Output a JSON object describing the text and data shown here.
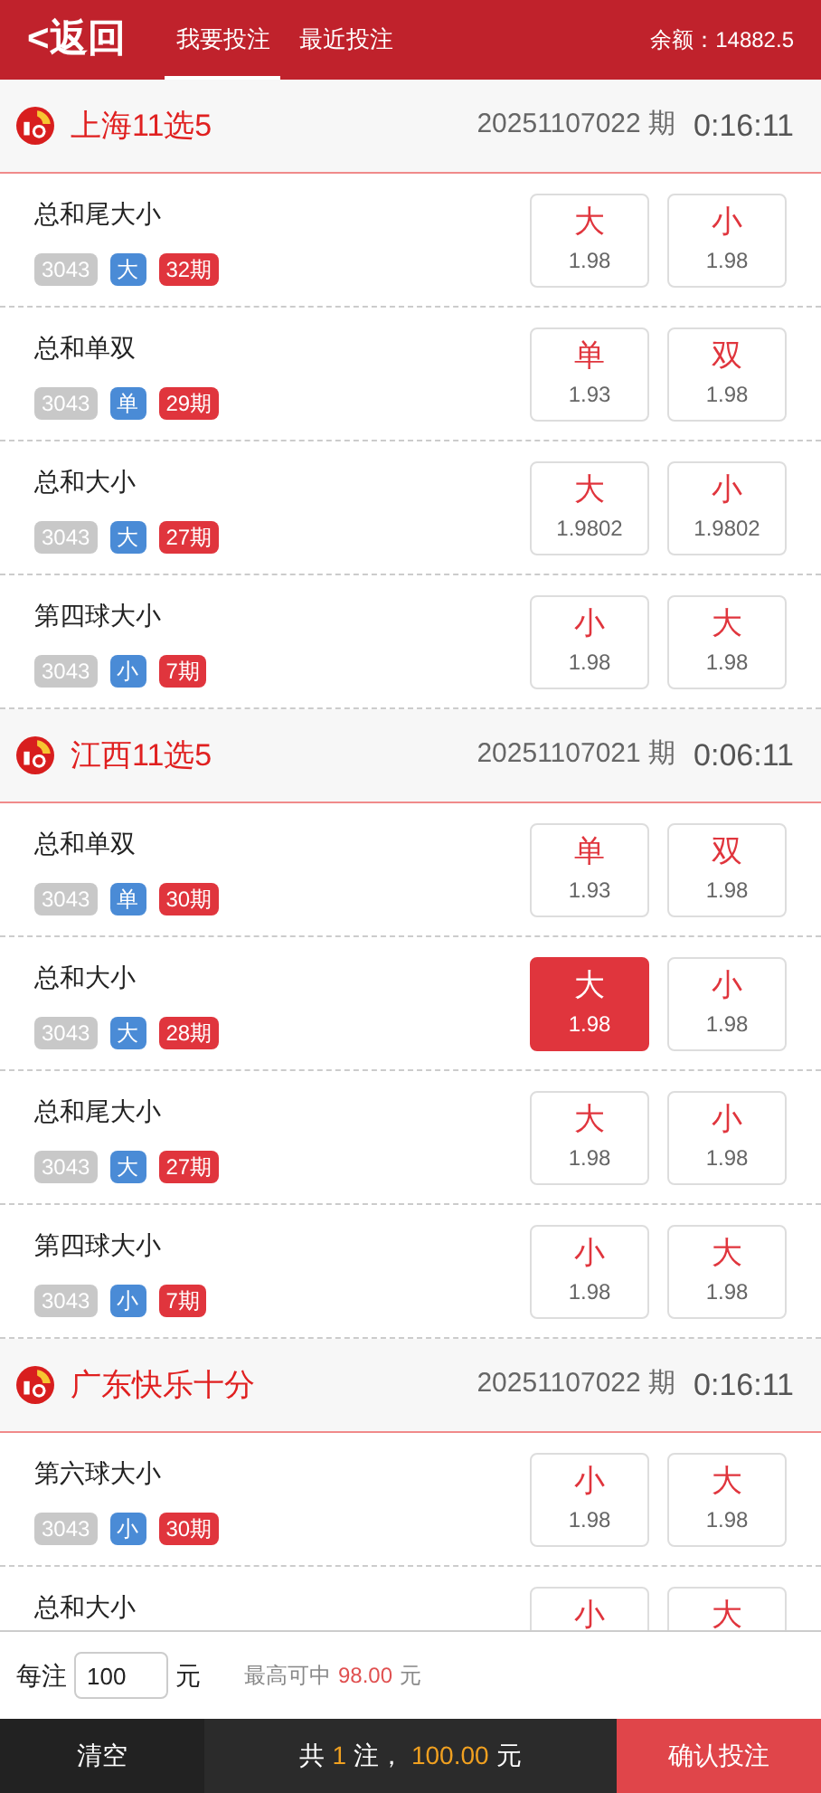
{
  "header": {
    "back_label": "<返回",
    "tabs": [
      {
        "label": "我要投注",
        "selected": true
      },
      {
        "label": "最近投注",
        "selected": false
      }
    ],
    "balance": "余额：14882.5"
  },
  "sections": [
    {
      "name": "上海11选5",
      "issue": "20251107022 期",
      "countdown": "0:16:11",
      "rows": [
        {
          "title": "总和尾大小",
          "badges": [
            {
              "kind": "count",
              "text": "3043"
            },
            {
              "kind": "trend",
              "text": "大"
            },
            {
              "kind": "streak",
              "text": "32期"
            }
          ],
          "options": [
            {
              "label": "大",
              "odds": "1.98",
              "selected": false
            },
            {
              "label": "小",
              "odds": "1.98",
              "selected": false
            }
          ]
        },
        {
          "title": "总和单双",
          "badges": [
            {
              "kind": "count",
              "text": "3043"
            },
            {
              "kind": "trend",
              "text": "单"
            },
            {
              "kind": "streak",
              "text": "29期"
            }
          ],
          "options": [
            {
              "label": "单",
              "odds": "1.93",
              "selected": false
            },
            {
              "label": "双",
              "odds": "1.98",
              "selected": false
            }
          ]
        },
        {
          "title": "总和大小",
          "badges": [
            {
              "kind": "count",
              "text": "3043"
            },
            {
              "kind": "trend",
              "text": "大"
            },
            {
              "kind": "streak",
              "text": "27期"
            }
          ],
          "options": [
            {
              "label": "大",
              "odds": "1.9802",
              "selected": false
            },
            {
              "label": "小",
              "odds": "1.9802",
              "selected": false
            }
          ]
        },
        {
          "title": "第四球大小",
          "badges": [
            {
              "kind": "count",
              "text": "3043"
            },
            {
              "kind": "trend",
              "text": "小"
            },
            {
              "kind": "streak",
              "text": "7期"
            }
          ],
          "options": [
            {
              "label": "小",
              "odds": "1.98",
              "selected": false
            },
            {
              "label": "大",
              "odds": "1.98",
              "selected": false
            }
          ]
        }
      ]
    },
    {
      "name": "江西11选5",
      "issue": "20251107021 期",
      "countdown": "0:06:11",
      "rows": [
        {
          "title": "总和单双",
          "badges": [
            {
              "kind": "count",
              "text": "3043"
            },
            {
              "kind": "trend",
              "text": "单"
            },
            {
              "kind": "streak",
              "text": "30期"
            }
          ],
          "options": [
            {
              "label": "单",
              "odds": "1.93",
              "selected": false
            },
            {
              "label": "双",
              "odds": "1.98",
              "selected": false
            }
          ]
        },
        {
          "title": "总和大小",
          "badges": [
            {
              "kind": "count",
              "text": "3043"
            },
            {
              "kind": "trend",
              "text": "大"
            },
            {
              "kind": "streak",
              "text": "28期"
            }
          ],
          "options": [
            {
              "label": "大",
              "odds": "1.98",
              "selected": true
            },
            {
              "label": "小",
              "odds": "1.98",
              "selected": false
            }
          ]
        },
        {
          "title": "总和尾大小",
          "badges": [
            {
              "kind": "count",
              "text": "3043"
            },
            {
              "kind": "trend",
              "text": "大"
            },
            {
              "kind": "streak",
              "text": "27期"
            }
          ],
          "options": [
            {
              "label": "大",
              "odds": "1.98",
              "selected": false
            },
            {
              "label": "小",
              "odds": "1.98",
              "selected": false
            }
          ]
        },
        {
          "title": "第四球大小",
          "badges": [
            {
              "kind": "count",
              "text": "3043"
            },
            {
              "kind": "trend",
              "text": "小"
            },
            {
              "kind": "streak",
              "text": "7期"
            }
          ],
          "options": [
            {
              "label": "小",
              "odds": "1.98",
              "selected": false
            },
            {
              "label": "大",
              "odds": "1.98",
              "selected": false
            }
          ]
        }
      ]
    },
    {
      "name": "广东快乐十分",
      "issue": "20251107022 期",
      "countdown": "0:16:11",
      "rows": [
        {
          "title": "第六球大小",
          "badges": [
            {
              "kind": "count",
              "text": "3043"
            },
            {
              "kind": "trend",
              "text": "小"
            },
            {
              "kind": "streak",
              "text": "30期"
            }
          ],
          "options": [
            {
              "label": "小",
              "odds": "1.98",
              "selected": false
            },
            {
              "label": "大",
              "odds": "1.98",
              "selected": false
            }
          ]
        },
        {
          "title": "总和大小",
          "options": [
            {
              "label": "小",
              "selected": false
            },
            {
              "label": "大",
              "selected": false
            }
          ]
        }
      ]
    }
  ],
  "bet": {
    "label": "每注",
    "value": "100",
    "unit": "元",
    "max_win_label": "最高可中",
    "max_win_value": "98.00",
    "max_win_unit": "元"
  },
  "footer": {
    "clear": "清空",
    "summary": {
      "prefix": "共",
      "count": "1",
      "middle": "注，",
      "amount": "100.00",
      "unit": "元"
    },
    "confirm": "确认投注"
  }
}
